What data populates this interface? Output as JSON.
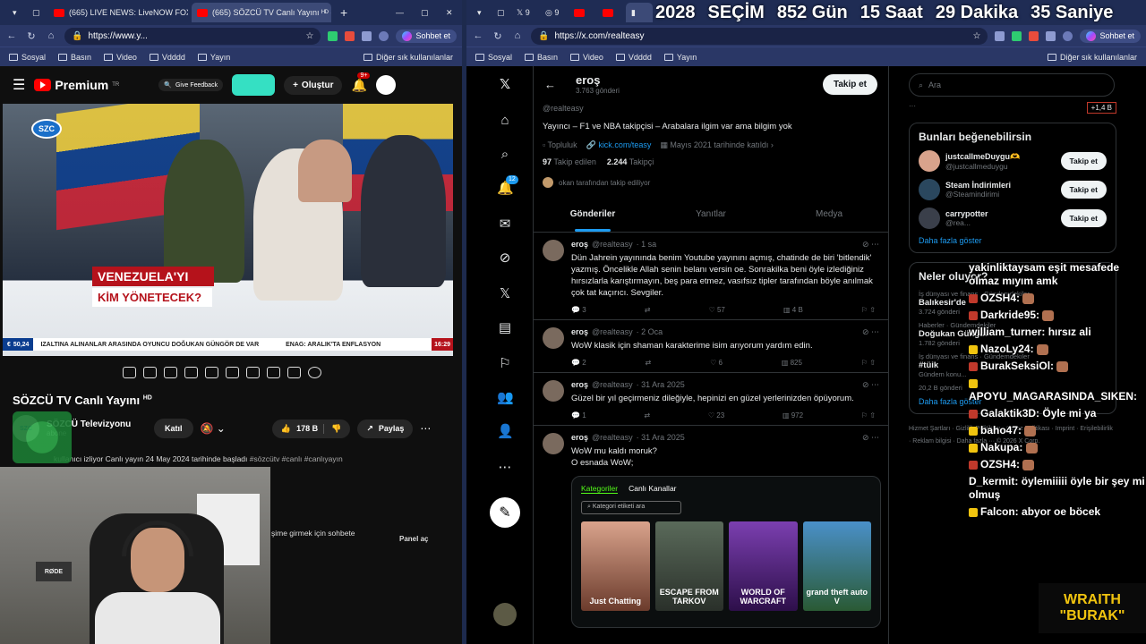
{
  "left_browser": {
    "tabs": [
      {
        "label": "(665) LIVE NEWS: LiveNOW FOX 24/",
        "active": false
      },
      {
        "label": "(665) SÖZCÜ TV Canlı Yayını ᴴᴰ - Yo",
        "active": true
      }
    ],
    "url": "https://www.y...",
    "copilot": "Sohbet et",
    "bookmarks": [
      "Sosyal",
      "Basın",
      "Video",
      "Vdddd",
      "Yayın"
    ],
    "bookmarks_other": "Diğer sık kullanılanlar"
  },
  "youtube": {
    "logo": "Premium",
    "logo_sup": "TR",
    "feedback": "Give Feedback",
    "create": "Oluştur",
    "notif_count": "9+",
    "video": {
      "channel_logo": "SZC",
      "title_line1": "VENEZUELA'YI",
      "title_line2": "KİM YÖNETECEK?",
      "exchange": "50,24",
      "ticker": "IZALTINA ALINANLAR ARASINDA OYUNCU DOĞUKAN GÜNGÖR DE VAR",
      "ticker2": "ENAG: ARALIK'TA ENFLASYON",
      "time": "16:29"
    },
    "title": "SÖZCÜ TV Canlı Yayını",
    "title_sup": "HD",
    "channel": "SÖZCÜ Televizyonu",
    "subs": "abone",
    "join": "Katıl",
    "likes": "178 B",
    "share": "Paylaş",
    "desc_prefix": "kullanıcı izliyor  Canlı yayın 24 May 2024 tarihinde başladı",
    "desc_tags": "#sözcütv #canlı #canlıyayın",
    "chat_prompt": "şime girmek için sohbete",
    "panel_open": "Panel aç",
    "mic_label": "RØDE"
  },
  "right_browser": {
    "url": "https://x.com/realteasy",
    "copilot": "Sohbet et",
    "bookmarks": [
      "Sosyal",
      "Basın",
      "Video",
      "Vdddd",
      "Yayın"
    ],
    "bookmarks_other": "Diğer sık kullanılanlar"
  },
  "countdown": {
    "year": "2028",
    "label": "SEÇİM",
    "days": "852 Gün",
    "hours": "15 Saat",
    "minutes": "29 Dakika",
    "seconds": "35 Saniye"
  },
  "x_nav": {
    "notif_count": "12"
  },
  "profile": {
    "name": "eroş",
    "posts": "3.763 gönderi",
    "follow": "Takip et",
    "handle": "@realteasy",
    "bio": "Yayıncı – F1 ve NBA takipçisi – Arabalara ilgim var ama bilgim yok",
    "category": "Topluluk",
    "link": "kick.com/teasy",
    "joined": "Mayıs 2021 tarihinde katıldı",
    "following": "97",
    "following_label": "Takip edilen",
    "followers": "2.244",
    "followers_label": "Takipçi",
    "followed_by": "okan tarafından takip ediliyor",
    "tabs": [
      "Gönderiler",
      "Yanıtlar",
      "Medya"
    ]
  },
  "tweets": [
    {
      "name": "eroş",
      "handle": "@realteasy",
      "time": "· 1 sa",
      "text": "Dün Jahrein yayınında benim Youtube yayınını açmış, chatinde de biri 'bitlendik' yazmış. Öncelikle Allah senin belanı versin oe. Sonrakilka beni öyle izlediğiniz hırsızlarla karıştırmayın, beş para etmez, vasıfsız tipler tarafından böyle anılmak çok tat kaçırıcı. Sevgiler.",
      "replies": "3",
      "likes": "57",
      "views": "4 B"
    },
    {
      "name": "eroş",
      "handle": "@realteasy",
      "time": "· 2 Oca",
      "text": "WoW klasik için shaman karakterime isim arıyorum yardım edin.",
      "replies": "2",
      "likes": "6",
      "views": "825"
    },
    {
      "name": "eroş",
      "handle": "@realteasy",
      "time": "· 31 Ara 2025",
      "text": "Güzel bir yıl geçirmeniz dileğiyle, hepinizi en güzel yerlerinizden öpüyorum.",
      "replies": "1",
      "likes": "23",
      "views": "972"
    },
    {
      "name": "eroş",
      "handle": "@realteasy",
      "time": "· 31 Ara 2025",
      "text": "WoW mu kaldı moruk?\nO esnada WoW;",
      "replies": "",
      "likes": "",
      "views": ""
    }
  ],
  "kick_card": {
    "tab1": "Kategoriler",
    "tab2": "Canlı Kanallar",
    "search": "Kategori etiketi ara",
    "games": [
      "Just Chatting",
      "ESCAPE FROM TARKOV",
      "WORLD OF WARCRAFT",
      "grand theft auto V"
    ]
  },
  "x_right": {
    "search": "Ara",
    "promo_count": "+1,4 B",
    "who_title": "Bunları beğenebilirsin",
    "who": [
      {
        "name": "justcallmeDuygu🫶",
        "handle": "@justcallmeduygu",
        "btn": "Takip et"
      },
      {
        "name": "Steam İndirimleri",
        "handle": "@Steamindirimi",
        "btn": "Takip et"
      },
      {
        "name": "carrypotter",
        "handle": "@rea...",
        "btn": "Takip et"
      }
    ],
    "more": "Daha fazla göster",
    "trends_title": "Neler oluyor?",
    "trends": [
      {
        "cat": "İş dünyası ve finans · Gündemdekiler",
        "name": "Balıkesir'de",
        "count": "3.724 gönderi"
      },
      {
        "cat": "Haberler · Gündemdekiler",
        "name": "Doğukan Güngör",
        "count": "1.782 gönderi"
      },
      {
        "cat": "İş dünyası ve finans · Gündemdekiler",
        "name": "#tüik",
        "count": "Gündem konu..."
      },
      {
        "cat": "",
        "name": "",
        "count": "20,2 B gönderi"
      }
    ],
    "more2": "Daha fazla göster",
    "footer": "Hizmet Şartları · Gizlilik Politikası · Çerez Politikası · Imprint · Erişilebilirlik · Reklam bilgisi · Daha fazla ··· © 2026 X Corp."
  },
  "chat": [
    {
      "user": "",
      "text": "yakinliktaysam eşit mesafede olmaz mıyım amk"
    },
    {
      "user": "OZSH4:",
      "text": ""
    },
    {
      "user": "Darkride95:",
      "text": ""
    },
    {
      "user": "william_turner:",
      "text": "hırsız ali"
    },
    {
      "user": "NazoLy24:",
      "text": ""
    },
    {
      "user": "BurakSeksiOl:",
      "text": ""
    },
    {
      "user": "APOYU_MAGARASINDA_SIKEN:",
      "text": ""
    },
    {
      "user": "Galaktik3D:",
      "text": "Öyle mi ya"
    },
    {
      "user": "baho47:",
      "text": ""
    },
    {
      "user": "Nakupa:",
      "text": ""
    },
    {
      "user": "OZSH4:",
      "text": ""
    },
    {
      "user": "D_kermit:",
      "text": "öylemiiiii öyle bir şey mi olmuş"
    },
    {
      "user": "Falcon:",
      "text": "abyor oe böcek"
    }
  ],
  "brand": {
    "line1": "WRAITH",
    "line2": "\"BURAK\""
  }
}
